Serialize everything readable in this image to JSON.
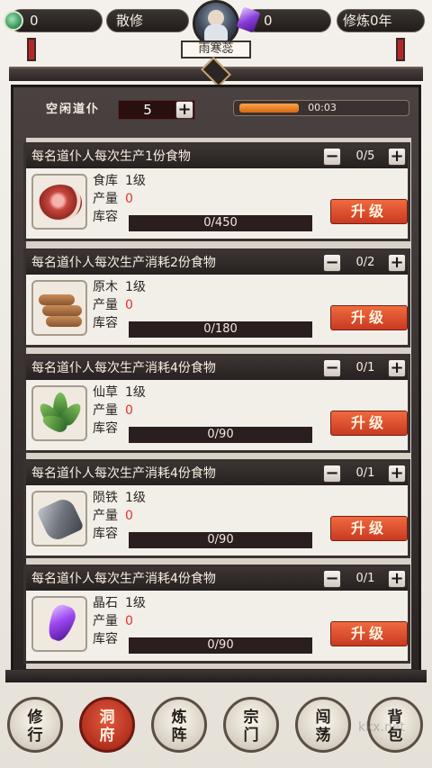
{
  "hud": {
    "jade_count": "0",
    "sect_name": "散修",
    "player_name": "雨寒蕊",
    "gem_count": "0",
    "cultivation": "修炼0年"
  },
  "idle": {
    "label": "空闲道仆",
    "value": "5",
    "plus": "+",
    "timer": "00:03",
    "timer_progress": 0.36
  },
  "cards": [
    {
      "title": "每名道仆人每次生产1份食物",
      "count": "0/5",
      "name": "食库",
      "level": "1级",
      "output_label": "产量",
      "output": "0",
      "capacity_label": "库容",
      "capacity": "0/450",
      "upgrade": "升级",
      "icon": "meat-icon"
    },
    {
      "title": "每名道仆人每次生产消耗2份食物",
      "count": "0/2",
      "name": "原木",
      "level": "1级",
      "output_label": "产量",
      "output": "0",
      "capacity_label": "库容",
      "capacity": "0/180",
      "upgrade": "升级",
      "icon": "wood-log-icon"
    },
    {
      "title": "每名道仆人每次生产消耗4份食物",
      "count": "0/1",
      "name": "仙草",
      "level": "1级",
      "output_label": "产量",
      "output": "0",
      "capacity_label": "库容",
      "capacity": "0/90",
      "upgrade": "升级",
      "icon": "herb-icon"
    },
    {
      "title": "每名道仆人每次生产消耗4份食物",
      "count": "0/1",
      "name": "陨铁",
      "level": "1级",
      "output_label": "产量",
      "output": "0",
      "capacity_label": "库容",
      "capacity": "0/90",
      "upgrade": "升级",
      "icon": "iron-ore-icon"
    },
    {
      "title": "每名道仆人每次生产消耗4份食物",
      "count": "0/1",
      "name": "晶石",
      "level": "1级",
      "output_label": "产量",
      "output": "0",
      "capacity_label": "库容",
      "capacity": "0/90",
      "upgrade": "升级",
      "icon": "crystal-gem-icon"
    }
  ],
  "nav": [
    {
      "l1": "修",
      "l2": "行"
    },
    {
      "l1": "洞",
      "l2": "府"
    },
    {
      "l1": "炼",
      "l2": "阵"
    },
    {
      "l1": "宗",
      "l2": "门"
    },
    {
      "l1": "闯",
      "l2": "荡"
    },
    {
      "l1": "背",
      "l2": "包"
    }
  ],
  "watermark": "kkx.net",
  "colors": {
    "accent_red": "#c93a21",
    "output_red": "#e0332d",
    "timer_orange": "#ffa348",
    "frame_dark": "#2a2423"
  }
}
